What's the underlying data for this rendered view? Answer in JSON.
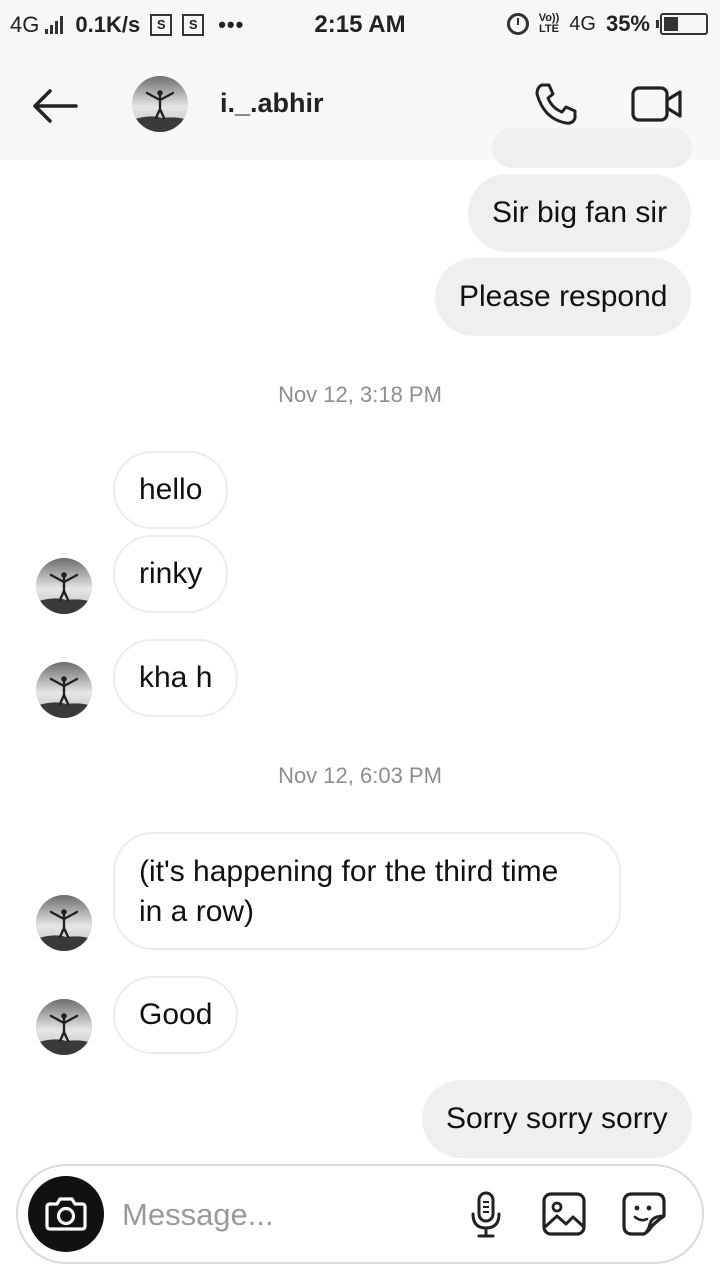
{
  "status_bar": {
    "network": "4G",
    "speed": "0.1K/s",
    "sim_icon_letter": "S",
    "more": "•••",
    "time": "2:15 AM",
    "volte_top": "Vo))",
    "volte_bottom": "LTE",
    "lte": "4G",
    "battery": "35%",
    "battery_level": 0.35
  },
  "header": {
    "username": "i._.abhir"
  },
  "messages": [
    {
      "type": "sent",
      "text": "Sir big fan sir"
    },
    {
      "type": "sent",
      "text": "Please respond"
    },
    {
      "type": "timestamp",
      "text": "Nov 12, 3:18 PM"
    },
    {
      "type": "received",
      "text": "hello"
    },
    {
      "type": "received",
      "text": "rinky"
    },
    {
      "type": "received",
      "text": "kha h"
    },
    {
      "type": "timestamp",
      "text": "Nov 12, 6:03 PM"
    },
    {
      "type": "received",
      "text_line1": "(it's happening for the third time",
      "text_line2": "in a row)"
    },
    {
      "type": "received",
      "text": "Good"
    },
    {
      "type": "sent",
      "text": "Sorry sorry sorry"
    }
  ],
  "composer": {
    "placeholder": "Message..."
  },
  "icons": {
    "back": "arrow-left-icon",
    "call": "phone-icon",
    "video": "video-camera-icon",
    "camera": "camera-icon",
    "mic": "microphone-icon",
    "gallery": "image-icon",
    "sticker": "sticker-icon"
  }
}
